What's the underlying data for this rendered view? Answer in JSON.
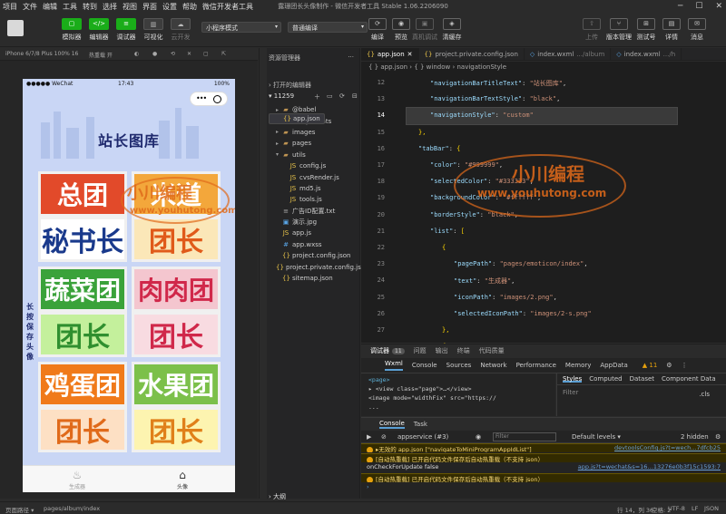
{
  "menu": {
    "items": [
      "项目",
      "文件",
      "编辑",
      "工具",
      "转到",
      "选择",
      "视图",
      "界面",
      "设置",
      "帮助",
      "微信开发者工具"
    ],
    "window_title": "露珊团长头像制作 - 微信开发者工具 Stable 1.06.2206090"
  },
  "toolbar": {
    "simulator": "模拟器",
    "editor": "编辑器",
    "debugger": "调试器",
    "visual": "可视化",
    "cloud": "云开发",
    "mode_select": "小程序模式",
    "compile_select": "普通编译",
    "compile": "编译",
    "preview": "预览",
    "real_debug": "真机调试",
    "clear_cache": "清缓存",
    "upload": "上传",
    "version": "版本管理",
    "test": "测试号",
    "details": "详情",
    "messages": "消息"
  },
  "simulator": {
    "device": "iPhone 6/7/8 Plus 100% 16",
    "hot_reload": "热重载 开",
    "status_carrier": "●●●●● WeChat",
    "status_time": "17:43",
    "status_battery": "100%",
    "page_title": "站长图库",
    "side_text": "长按保存头像",
    "tiles": [
      {
        "top": "总团",
        "bottom": "秘书长"
      },
      {
        "top": "米道",
        "bottom": "团长"
      },
      {
        "top": "蔬菜团",
        "bottom": "团长"
      },
      {
        "top": "肉肉团",
        "bottom": "团长"
      },
      {
        "top": "鸡蛋团",
        "bottom": "团长"
      },
      {
        "top": "水果团",
        "bottom": "团长"
      }
    ],
    "tabbar": [
      {
        "label": "生成器"
      },
      {
        "label": "头像"
      }
    ],
    "watermark_cn": "小川编程",
    "watermark_en": "www.youhutong.com",
    "page_path_label": "页面路径 ▾",
    "page_path": "pages/album/index"
  },
  "explorer": {
    "title": "资源管理器",
    "open_editors": "打开的编辑器",
    "project": "11259",
    "tree": [
      {
        "name": "@babel",
        "type": "folder",
        "indent": 1
      },
      {
        "name": "components",
        "type": "folder",
        "indent": 1
      },
      {
        "name": "images",
        "type": "folder",
        "indent": 1
      },
      {
        "name": "pages",
        "type": "folder",
        "indent": 1
      },
      {
        "name": "utils",
        "type": "folder-open",
        "indent": 1
      },
      {
        "name": "config.js",
        "type": "js",
        "indent": 2
      },
      {
        "name": "cvsRender.js",
        "type": "js",
        "indent": 2
      },
      {
        "name": "md5.js",
        "type": "js",
        "indent": 2
      },
      {
        "name": "tools.js",
        "type": "js",
        "indent": 2
      },
      {
        "name": "广告ID配置.txt",
        "type": "txt",
        "indent": 1
      },
      {
        "name": "演示.jpg",
        "type": "img",
        "indent": 1
      },
      {
        "name": "app.js",
        "type": "js",
        "indent": 1
      },
      {
        "name": "app.json",
        "type": "json",
        "indent": 1
      },
      {
        "name": "app.wxss",
        "type": "wxss",
        "indent": 1
      },
      {
        "name": "project.config.json",
        "type": "json",
        "indent": 1
      },
      {
        "name": "project.private.config.js...",
        "type": "json",
        "indent": 1
      },
      {
        "name": "sitemap.json",
        "type": "json",
        "indent": 1
      }
    ],
    "outline": "大纲"
  },
  "editor": {
    "tabs": [
      {
        "label": "app.json",
        "icon": "{}"
      },
      {
        "label": "project.private.config.json",
        "icon": "{}"
      },
      {
        "label": "index.wxml",
        "suffix": ".../album",
        "icon": "◇"
      },
      {
        "label": "index.wxml",
        "suffix": ".../h",
        "icon": "◇"
      }
    ],
    "breadcrumb": "{ } app.json › { } window › navigationStyle",
    "lines": [
      {
        "n": "12",
        "indent": 2,
        "key": "\"navigationBarTitleText\"",
        "val": "\"站长图库\"",
        "end": ","
      },
      {
        "n": "13",
        "indent": 2,
        "key": "\"navigationBarTextStyle\"",
        "val": "\"black\"",
        "end": ","
      },
      {
        "n": "14",
        "indent": 2,
        "key": "\"navigationStyle\"",
        "val": "\"custom\"",
        "end": ""
      },
      {
        "n": "15",
        "indent": 1,
        "raw": "},"
      },
      {
        "n": "16",
        "indent": 1,
        "key": "\"tabBar\"",
        "raw_after": "{"
      },
      {
        "n": "17",
        "indent": 2,
        "key": "\"color\"",
        "val": "\"#999999\"",
        "end": ","
      },
      {
        "n": "18",
        "indent": 2,
        "key": "\"selectedColor\"",
        "val": "\"#333333\"",
        "end": ","
      },
      {
        "n": "19",
        "indent": 2,
        "key": "\"backgroundColor\"",
        "val": "\"#ffffff\"",
        "end": ","
      },
      {
        "n": "20",
        "indent": 2,
        "key": "\"borderStyle\"",
        "val": "\"black\"",
        "end": ","
      },
      {
        "n": "21",
        "indent": 2,
        "key": "\"list\"",
        "raw_after": "["
      },
      {
        "n": "22",
        "indent": 3,
        "raw": "{"
      },
      {
        "n": "23",
        "indent": 4,
        "key": "\"pagePath\"",
        "val": "\"pages/emoticon/index\"",
        "end": ","
      },
      {
        "n": "24",
        "indent": 4,
        "key": "\"text\"",
        "val": "\"生成器\"",
        "end": ","
      },
      {
        "n": "25",
        "indent": 4,
        "key": "\"iconPath\"",
        "val": "\"images/2.png\"",
        "end": ","
      },
      {
        "n": "26",
        "indent": 4,
        "key": "\"selectedIconPath\"",
        "val": "\"images/2-s.png\"",
        "end": ""
      },
      {
        "n": "27",
        "indent": 3,
        "raw": "},"
      },
      {
        "n": "28",
        "indent": 3,
        "raw": "{"
      }
    ]
  },
  "devtools": {
    "tabs": [
      "调试器",
      "问题",
      "输出",
      "终端",
      "代码质量"
    ],
    "badge": "11",
    "panels": [
      "Wxml",
      "Console",
      "Sources",
      "Network",
      "Performance",
      "Memory",
      "AppData"
    ],
    "warn_count": "▲ 11",
    "elements": [
      "<page>",
      "▸ <view class=\"page\">…</view>",
      "  <image mode=\"widthFix\" src=\"https://",
      "  ..."
    ],
    "styles_tabs": [
      "Styles",
      "Computed",
      "Dataset",
      "Component Data"
    ],
    "styles_filter": "Filter",
    "styles_cls": ".cls",
    "console_tabs": [
      "Console",
      "Task"
    ],
    "context": "appservice (#3)",
    "filter_placeholder": "Filter",
    "levels": "Default levels ▾",
    "hidden": "2 hidden",
    "logs": [
      {
        "type": "warn",
        "text": "▸无效的 app.json [\"navigateToMiniProgramAppIdList\"]",
        "src": "devtoolsConfig.js?t=wech...7dfcb25"
      },
      {
        "type": "warn",
        "text": "[自动热重载] 已开启代码文件保存后自动热重载（不支持 json）",
        "src": ""
      },
      {
        "type": "log",
        "text": "onCheckForUpdate false",
        "src": "app.js?t=wechat&s=16…13276e0b3f15c1593:7"
      },
      {
        "type": "warn",
        "text": "[自动热重载] 已开启代码文件保存后自动热重载（不支持 json）",
        "src": ""
      },
      {
        "type": "prompt",
        "text": "›",
        "src": ""
      }
    ]
  },
  "statusbar": {
    "position": "行 14，列 36",
    "spaces": "空格: 2",
    "encoding": "UTF-8",
    "eol": "LF",
    "lang": "JSON"
  },
  "colors": {
    "accent_green": "#1aad19",
    "watermark": "#e06a1a",
    "editor_bg": "#1e1e1e"
  }
}
